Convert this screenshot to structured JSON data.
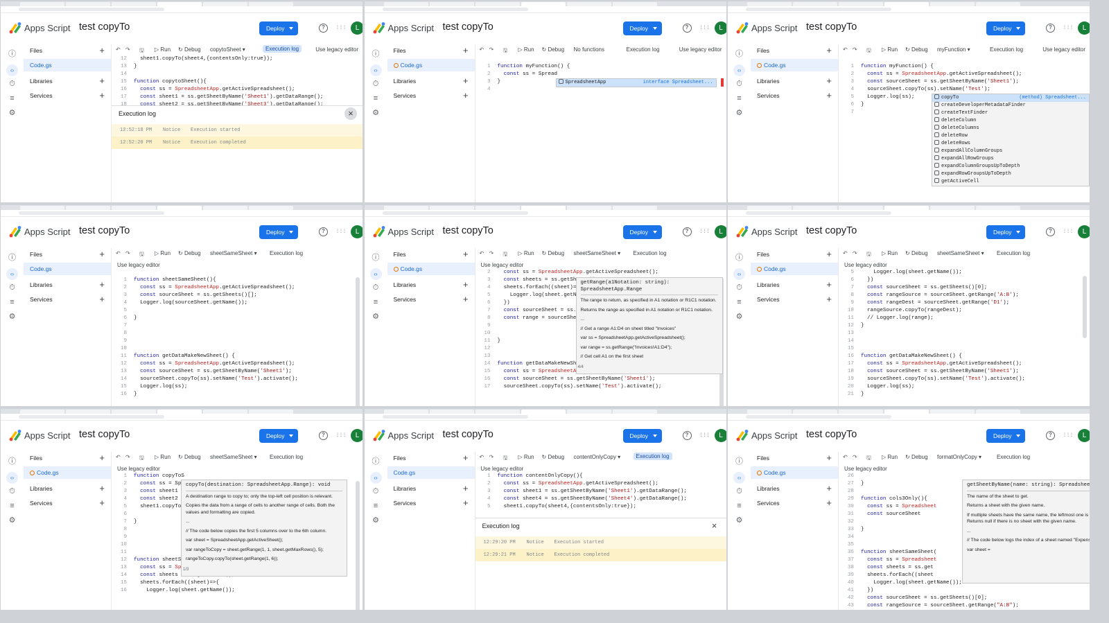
{
  "panels": [
    {
      "app_title": "Apps Script",
      "project_title": "test copyTo",
      "deploy_label": "Deploy",
      "avatar_letter": "L",
      "sidebar": {
        "files": "Files",
        "file": "Code.gs",
        "libraries": "Libraries",
        "services": "Services"
      },
      "toolbar": {
        "run": "Run",
        "debug": "Debug",
        "function": "copytoSheet",
        "exec": "Execution log",
        "exec_active": true,
        "legacy": "Use legacy editor",
        "legacy_in_toolbar": true
      },
      "code_lines": [
        {
          "n": "12",
          "t": "  sheet1.copyTo(sheet4,{contentsOnly:true});"
        },
        {
          "n": "13",
          "t": "}"
        },
        {
          "n": "14",
          "t": ""
        },
        {
          "n": "15",
          "t": "function copytoSheet(){"
        },
        {
          "n": "16",
          "t": "  const ss = SpreadsheetApp.getActiveSpreadsheet();"
        },
        {
          "n": "17",
          "t": "  const sheet1 = ss.getSheetByName('Sheet1').getDataRange();"
        },
        {
          "n": "18",
          "t": "  const sheet2 = ss.getSheetByName('Sheet3').getDataRange();"
        }
      ],
      "exec_log": {
        "title": "Execution log",
        "entries": [
          {
            "time": "12:52:18 PM",
            "level": "Notice",
            "msg": "Execution started"
          },
          {
            "time": "12:52:20 PM",
            "level": "Notice",
            "msg": "Execution completed"
          }
        ]
      }
    },
    {
      "app_title": "Apps Script",
      "project_title": "test copyTo",
      "deploy_label": "Deploy",
      "avatar_letter": "L",
      "sidebar": {
        "files": "Files",
        "file": "Code.gs",
        "libraries": "Libraries",
        "services": "Services"
      },
      "toolbar": {
        "run": "Run",
        "debug": "Debug",
        "function": "No functions",
        "exec": "Execution log",
        "exec_active": false,
        "legacy": "Use legacy editor",
        "legacy_in_toolbar": true
      },
      "code_lines": [
        {
          "n": "1",
          "t": "function myFunction() {"
        },
        {
          "n": "2",
          "t": "  const ss = Spread"
        },
        {
          "n": "3",
          "t": "}"
        },
        {
          "n": "4",
          "t": ""
        }
      ],
      "suggest": [
        {
          "label": "SpreadsheetApp",
          "type": "interface Spreadsheet..."
        }
      ]
    },
    {
      "app_title": "Apps Script",
      "project_title": "test copyTo",
      "deploy_label": "Deploy",
      "avatar_letter": "L",
      "sidebar": {
        "files": "Files",
        "file": "Code.gs",
        "libraries": "Libraries",
        "services": "Services"
      },
      "toolbar": {
        "run": "Run",
        "debug": "Debug",
        "function": "myFunction",
        "exec": "Execution log",
        "exec_active": false,
        "legacy": "Use legacy editor",
        "legacy_in_toolbar": true
      },
      "code_lines": [
        {
          "n": "1",
          "t": "function myFunction() {"
        },
        {
          "n": "2",
          "t": "  const ss = SpreadsheetApp.getActiveSpreadsheet();"
        },
        {
          "n": "3",
          "t": "  const sourceSheet = ss.getSheetByName('Sheet1');"
        },
        {
          "n": "4",
          "t": "  sourceSheet.copyTo(ss).setName('Test');"
        },
        {
          "n": "5",
          "t": "  Logger.log(ss);"
        },
        {
          "n": "6",
          "t": "}"
        },
        {
          "n": "7",
          "t": ""
        }
      ],
      "suggest": [
        {
          "label": "copyTo",
          "type": "(method) Spreadsheet..."
        },
        {
          "label": "createDeveloperMetadataFinder",
          "type": ""
        },
        {
          "label": "createTextFinder",
          "type": ""
        },
        {
          "label": "deleteColumn",
          "type": ""
        },
        {
          "label": "deleteColumns",
          "type": ""
        },
        {
          "label": "deleteRow",
          "type": ""
        },
        {
          "label": "deleteRows",
          "type": ""
        },
        {
          "label": "expandAllColumnGroups",
          "type": ""
        },
        {
          "label": "expandAllRowGroups",
          "type": ""
        },
        {
          "label": "expandColumnGroupsUpToDepth",
          "type": ""
        },
        {
          "label": "expandRowGroupsUpToDepth",
          "type": ""
        },
        {
          "label": "getActiveCell",
          "type": ""
        }
      ]
    },
    {
      "app_title": "Apps Script",
      "project_title": "test copyTo",
      "deploy_label": "Deploy",
      "avatar_letter": "L",
      "sidebar": {
        "files": "Files",
        "file": "Code.gs",
        "libraries": "Libraries",
        "services": "Services"
      },
      "toolbar": {
        "run": "Run",
        "debug": "Debug",
        "function": "sheetSameSheet",
        "exec": "Execution log",
        "exec_active": false,
        "legacy": "Use legacy editor",
        "legacy_in_toolbar": false
      },
      "code_lines": [
        {
          "n": "1",
          "t": "function sheetSameSheet(){"
        },
        {
          "n": "2",
          "t": "  const ss = SpreadsheetApp.getActiveSpreadsheet();"
        },
        {
          "n": "3",
          "t": "  const sourceSheet = ss.getSheets()[];"
        },
        {
          "n": "4",
          "t": "  Logger.log(sourceSheet.getName());"
        },
        {
          "n": "5",
          "t": ""
        },
        {
          "n": "6",
          "t": "}"
        },
        {
          "n": "7",
          "t": ""
        },
        {
          "n": "8",
          "t": ""
        },
        {
          "n": "9",
          "t": ""
        },
        {
          "n": "10",
          "t": ""
        },
        {
          "n": "11",
          "t": "function getDataMakeNewSheet() {"
        },
        {
          "n": "12",
          "t": "  const ss = SpreadsheetApp.getActiveSpreadsheet();"
        },
        {
          "n": "13",
          "t": "  const sourceSheet = ss.getSheetByName('Sheet1');"
        },
        {
          "n": "14",
          "t": "  sourceSheet.copyTo(ss).setName('Test').activate();"
        },
        {
          "n": "15",
          "t": "  Logger.log(ss);"
        },
        {
          "n": "16",
          "t": "}"
        }
      ]
    },
    {
      "app_title": "Apps Script",
      "project_title": "test copyTo",
      "deploy_label": "Deploy",
      "avatar_letter": "L",
      "sidebar": {
        "files": "Files",
        "file": "Code.gs",
        "libraries": "Libraries",
        "services": "Services"
      },
      "toolbar": {
        "run": "Run",
        "debug": "Debug",
        "function": "sheetSameSheet",
        "exec": "Execution log",
        "exec_active": false,
        "legacy": "Use legacy editor",
        "legacy_in_toolbar": false
      },
      "code_lines": [
        {
          "n": "2",
          "t": "  const ss = SpreadsheetApp.getActiveSpreadsheet();"
        },
        {
          "n": "3",
          "t": "  const sheets = ss.getSheets();"
        },
        {
          "n": "4",
          "t": "  sheets.forEach((sheet)=>{"
        },
        {
          "n": "5",
          "t": "    Logger.log(sheet.getName());"
        },
        {
          "n": "6",
          "t": "  })"
        },
        {
          "n": "7",
          "t": "  const sourceSheet = ss.getSheets()[0];"
        },
        {
          "n": "8",
          "t": "  const range = sourceSheet.getRange();"
        },
        {
          "n": "9",
          "t": ""
        },
        {
          "n": "10",
          "t": ""
        },
        {
          "n": "11",
          "t": "}"
        },
        {
          "n": "12",
          "t": ""
        },
        {
          "n": "13",
          "t": ""
        },
        {
          "n": "14",
          "t": "function getDataMakeNewSheet() {"
        },
        {
          "n": "15",
          "t": "  const ss = SpreadsheetApp.getActiveSpreadsheet();"
        },
        {
          "n": "16",
          "t": "  const sourceSheet = ss.getSheetByName('Sheet1');"
        },
        {
          "n": "17",
          "t": "  sourceSheet.copyTo(ss).setName('Test').activate();"
        }
      ],
      "popup": {
        "sig": "getRange(a1Notation: string): SpreadsheetApp.Range",
        "lines": [
          "The range to return, as specified in A1 notation or R1C1 notation.",
          "Returns the range as specified in A1 notation or R1C1 notation.",
          "...",
          "// Get a range A1:D4 on sheet titled \"Invoices\"",
          "var ss = SpreadsheetApp.getActiveSpreadsheet();",
          "var range = ss.getRange(\"Invoices!A1:D4\");",
          "// Get cell A1 on the first sheet"
        ],
        "counter": "4/4"
      }
    },
    {
      "app_title": "Apps Script",
      "project_title": "test copyTo",
      "deploy_label": "Deploy",
      "avatar_letter": "L",
      "sidebar": {
        "files": "Files",
        "file": "Code.gs",
        "libraries": "Libraries",
        "services": "Services"
      },
      "toolbar": {
        "run": "Run",
        "debug": "Debug",
        "function": "sheetSameSheet",
        "exec": "Execution log",
        "exec_active": false,
        "legacy": "Use legacy editor",
        "legacy_in_toolbar": false
      },
      "code_lines": [
        {
          "n": "5",
          "t": "    Logger.log(sheet.getName());"
        },
        {
          "n": "6",
          "t": "  })"
        },
        {
          "n": "7",
          "t": "  const sourceSheet = ss.getSheets()[0];"
        },
        {
          "n": "8",
          "t": "  const rangeSource = sourceSheet.getRange('A:B');"
        },
        {
          "n": "9",
          "t": "  const rangeDest = sourceSheet.getRange('D1');"
        },
        {
          "n": "10",
          "t": "  rangeSource.copyTo(rangeDest);"
        },
        {
          "n": "11",
          "t": "  // Logger.log(range);"
        },
        {
          "n": "12",
          "t": "}"
        },
        {
          "n": "13",
          "t": ""
        },
        {
          "n": "14",
          "t": ""
        },
        {
          "n": "15",
          "t": ""
        },
        {
          "n": "16",
          "t": "function getDataMakeNewSheet() {"
        },
        {
          "n": "17",
          "t": "  const ss = SpreadsheetApp.getActiveSpreadsheet();"
        },
        {
          "n": "18",
          "t": "  const sourceSheet = ss.getSheetByName('Sheet1');"
        },
        {
          "n": "19",
          "t": "  sourceSheet.copyTo(ss).setName('Test').activate();"
        },
        {
          "n": "20",
          "t": "  Logger.log(ss);"
        },
        {
          "n": "21",
          "t": "}"
        }
      ]
    },
    {
      "app_title": "Apps Script",
      "project_title": "test copyTo",
      "deploy_label": "Deploy",
      "avatar_letter": "L",
      "sidebar": {
        "files": "Files",
        "file": "Code.gs",
        "libraries": "Libraries",
        "services": "Services"
      },
      "toolbar": {
        "run": "Run",
        "debug": "Debug",
        "function": "sheetSameSheet",
        "exec": "Execution log",
        "exec_active": false,
        "legacy": "Use legacy editor",
        "legacy_in_toolbar": false
      },
      "code_lines": [
        {
          "n": "1",
          "t": "function copyToS"
        },
        {
          "n": "2",
          "t": "  const ss = Sp"
        },
        {
          "n": "3",
          "t": "  const sheet1 ="
        },
        {
          "n": "4",
          "t": "  const sheet2 ="
        },
        {
          "n": "5",
          "t": "  sheet1.copyTo("
        },
        {
          "n": "6",
          "t": ""
        },
        {
          "n": "7",
          "t": "}"
        },
        {
          "n": "8",
          "t": ""
        },
        {
          "n": "9",
          "t": ""
        },
        {
          "n": "10",
          "t": ""
        },
        {
          "n": "11",
          "t": ""
        },
        {
          "n": "12",
          "t": "function sheetSa"
        },
        {
          "n": "13",
          "t": "  const ss = SpreadsheetApp.getActiveSpreadsheet();"
        },
        {
          "n": "14",
          "t": "  const sheets = ss.getSheets();"
        },
        {
          "n": "15",
          "t": "  sheets.forEach((sheet)=>{"
        },
        {
          "n": "16",
          "t": "    Logger.log(sheet.getName());"
        }
      ],
      "popup": {
        "sig": "copyTo(destination: SpreadsheetApp.Range): void",
        "lines": [
          "A destination range to copy to; only the top-left cell position is relevant.",
          "Copies the data from a range of cells to another range of cells. Both the values and formatting are copied.",
          "...",
          "// The code below copies the first 5 columns over to the 6th column.",
          "var sheet = SpreadsheetApp.getActiveSheet();",
          "var rangeToCopy = sheet.getRange(1, 1, sheet.getMaxRows(), 5);",
          "rangeToCopy.copyTo(sheet.getRange(1, 6));"
        ],
        "counter": "1/3"
      }
    },
    {
      "app_title": "Apps Script",
      "project_title": "test copyTo",
      "deploy_label": "Deploy",
      "avatar_letter": "L",
      "sidebar": {
        "files": "Files",
        "file": "Code.gs",
        "libraries": "Libraries",
        "services": "Services"
      },
      "toolbar": {
        "run": "Run",
        "debug": "Debug",
        "function": "contentOnlyCopy",
        "exec": "Execution log",
        "exec_active": true,
        "legacy": "Use legacy editor",
        "legacy_in_toolbar": false
      },
      "code_lines": [
        {
          "n": "1",
          "t": "function contentOnlyCopy(){"
        },
        {
          "n": "2",
          "t": "  const ss = SpreadsheetApp.getActiveSpreadsheet();"
        },
        {
          "n": "3",
          "t": "  const sheet1 = ss.getSheetByName('Sheet1').getDataRange();"
        },
        {
          "n": "4",
          "t": "  const sheet4 = ss.getSheetByName('Sheet4').getDataRange();"
        },
        {
          "n": "5",
          "t": "  sheet1.copyTo(sheet4,{contentsOnly:true});"
        }
      ],
      "exec_log": {
        "title": "Execution log",
        "entries": [
          {
            "time": "12:29:20 PM",
            "level": "Notice",
            "msg": "Execution started"
          },
          {
            "time": "12:29:21 PM",
            "level": "Notice",
            "msg": "Execution completed"
          }
        ]
      }
    },
    {
      "app_title": "Apps Script",
      "project_title": "test copyTo",
      "deploy_label": "Deploy",
      "avatar_letter": "L",
      "sidebar": {
        "files": "Files",
        "file": "Code.gs",
        "libraries": "Libraries",
        "services": "Services"
      },
      "toolbar": {
        "run": "Run",
        "debug": "Debug",
        "function": "formatOnlyCopy",
        "exec": "Execution log",
        "exec_active": false,
        "legacy": "Use legacy editor",
        "legacy_in_toolbar": false
      },
      "code_lines": [
        {
          "n": "26",
          "t": ""
        },
        {
          "n": "27",
          "t": "}"
        },
        {
          "n": "28",
          "t": ""
        },
        {
          "n": "29",
          "t": "function cols3Only(){"
        },
        {
          "n": "30",
          "t": "  const ss = Spreadsheet"
        },
        {
          "n": "31",
          "t": "  const sourceSheet"
        },
        {
          "n": "32",
          "t": ""
        },
        {
          "n": "33",
          "t": "}"
        },
        {
          "n": "34",
          "t": ""
        },
        {
          "n": "35",
          "t": ""
        },
        {
          "n": "36",
          "t": "function sheetSameSheet("
        },
        {
          "n": "37",
          "t": "  const ss = Spreadsheet"
        },
        {
          "n": "38",
          "t": "  const sheets = ss.get"
        },
        {
          "n": "39",
          "t": "  sheets.forEach((sheet"
        },
        {
          "n": "40",
          "t": "    Logger.log(sheet.getName());"
        },
        {
          "n": "41",
          "t": "  })"
        },
        {
          "n": "42",
          "t": "  const sourceSheet = ss.getSheets()[0];"
        },
        {
          "n": "43",
          "t": "  const rangeSource = sourceSheet.getRange(\"A:B\");"
        }
      ],
      "popup": {
        "sig": "getSheetByName(name: string): SpreadsheetApp.Sheet",
        "lines": [
          "The name of the sheet to get.",
          "Returns a sheet with the given name.",
          "If multiple sheets have the same name, the leftmost one is returned. Returns null if there is no sheet with the given name.",
          "...",
          "// The code below logs the index of a sheet named \"Expenses\"",
          "var sheet ="
        ],
        "counter": ""
      }
    }
  ]
}
